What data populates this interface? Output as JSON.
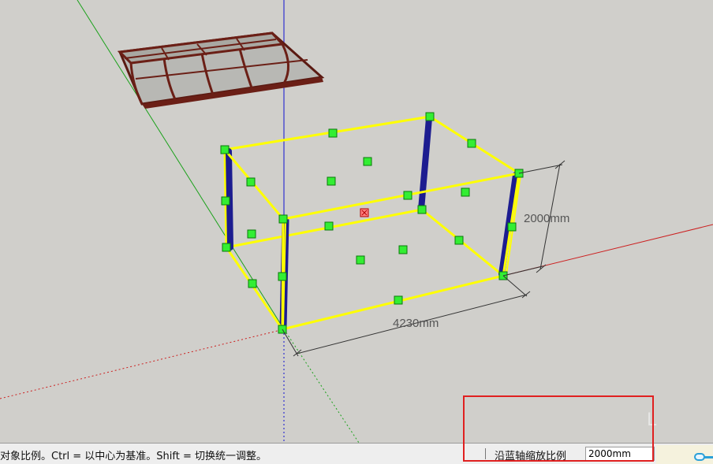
{
  "viewport": {
    "dimensions": [
      {
        "label": "2000mm"
      },
      {
        "label": "4230mm"
      }
    ],
    "colors": {
      "background": "#d0cfcb",
      "red_axis": "#cc2020",
      "green_axis": "#1aa11a",
      "blue_axis": "#1010d0",
      "bounding_box": "#ffff00",
      "grip": "#33ee33",
      "column": "#1c1c90",
      "canopy": "#6b1f16"
    }
  },
  "statusbar": {
    "hint": "对象比例。Ctrl = 以中心为基准。Shift = 切换统一调整。",
    "measurement_label": "沿蓝轴缩放比例",
    "measurement_value": "2000mm"
  }
}
